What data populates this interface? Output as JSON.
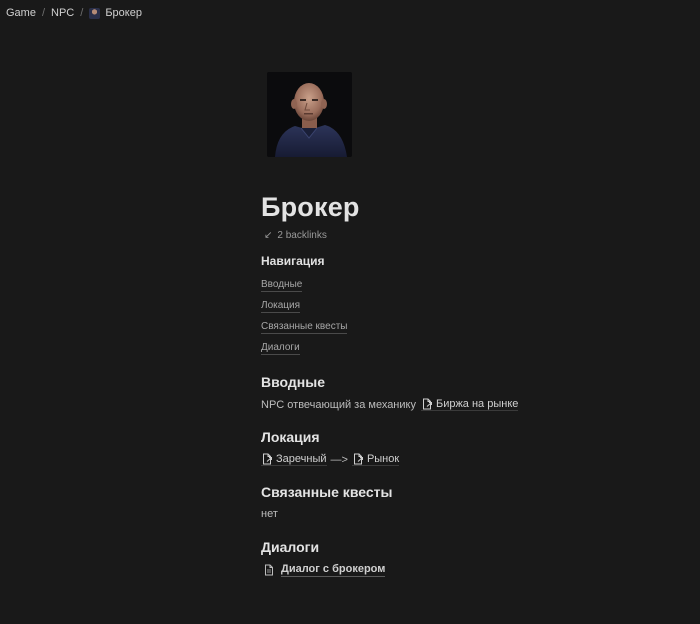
{
  "breadcrumb": {
    "items": [
      "Game",
      "NPC",
      "Брокер"
    ],
    "separator": "/"
  },
  "page": {
    "title": "Брокер",
    "backlinks": "2 backlinks",
    "toc_title": "Навигация",
    "toc": [
      "Вводные",
      "Локация",
      "Связанные квесты",
      "Диалоги"
    ],
    "sections": {
      "intro": {
        "heading": "Вводные",
        "text": "NPC отвечающий за механику",
        "link": "Биржа на рынке"
      },
      "location": {
        "heading": "Локация",
        "from": "Заречный",
        "arrow": "—>",
        "to": "Рынок"
      },
      "quests": {
        "heading": "Связанные квесты",
        "text": "нет"
      },
      "dialogs": {
        "heading": "Диалоги",
        "link": "Диалог с брокером"
      }
    }
  },
  "icons": {
    "backlinks": "arrow-down-left-icon",
    "page_link": "page-link-icon",
    "document": "document-icon"
  },
  "colors": {
    "background": "#191919",
    "text": "#d4d4d4",
    "muted": "#9a9a9a"
  }
}
